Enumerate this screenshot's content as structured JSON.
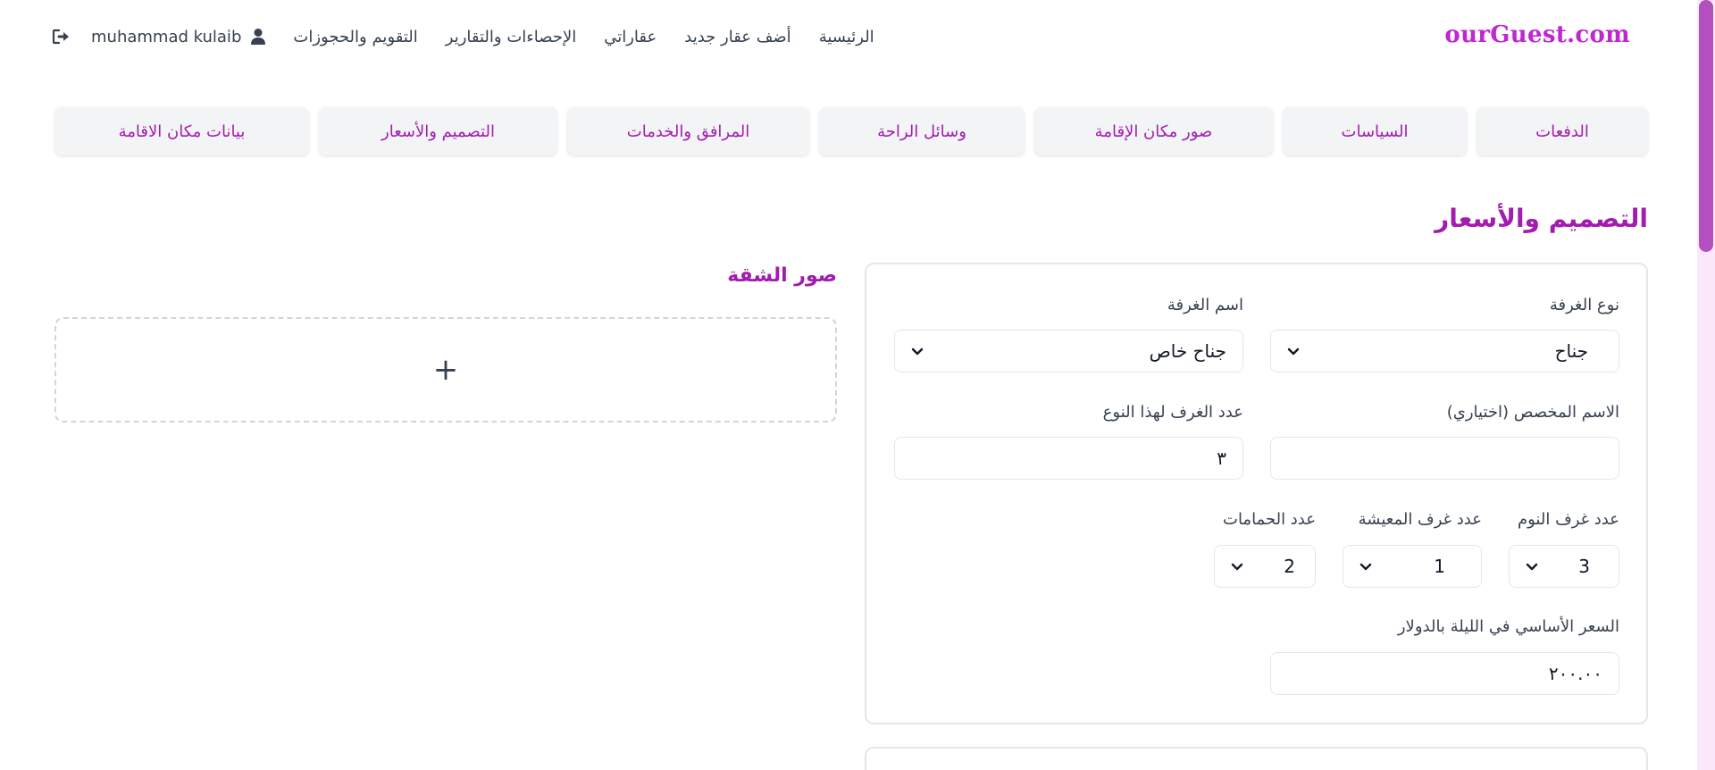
{
  "brand": "ourGuest.com",
  "nav": {
    "home": "الرئيسية",
    "add_property": "أضف عقار جديد",
    "my_properties": "عقاراتي",
    "stats": "الإحصاءات والتقارير",
    "calendar": "التقويم والحجوزات",
    "user_name": "muhammad kulaib"
  },
  "tabs": [
    "بيانات مكان الاقامة",
    "التصميم والأسعار",
    "المرافق والخدمات",
    "وسائل الراحة",
    "صور مكان الإقامة",
    "السياسات",
    "الدفعات"
  ],
  "section_title": "التصميم والأسعار",
  "form": {
    "room_type": {
      "label": "نوع الغرفة",
      "value": "جناح"
    },
    "room_name": {
      "label": "اسم الغرفة",
      "value": "جناح خاص"
    },
    "custom_name": {
      "label": "الاسم المخصص (اختياري)",
      "value": ""
    },
    "room_count": {
      "label": "عدد الغرف لهذا النوع",
      "value": "٣"
    },
    "bedrooms": {
      "label": "عدد غرف النوم",
      "value": "3"
    },
    "living_rooms": {
      "label": "عدد غرف المعيشة",
      "value": "1"
    },
    "bathrooms": {
      "label": "عدد الحمامات",
      "value": "2"
    },
    "base_price": {
      "label": "السعر الأساسي في الليلة بالدولار",
      "value": "٢٠٠.٠٠"
    }
  },
  "photos": {
    "title": "صور الشقة",
    "add_symbol": "+"
  },
  "colors": {
    "accent": "#a21caf",
    "brand": "#c026d3",
    "scrollbar_thumb": "#b44fc0"
  },
  "icons": {
    "logout": "logout-icon",
    "user": "user-icon",
    "select": "chevron-down-icon"
  }
}
